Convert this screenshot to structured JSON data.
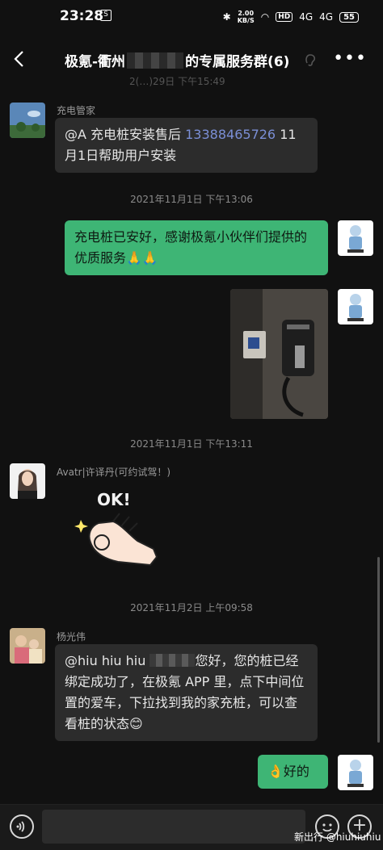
{
  "status_bar": {
    "time": "23:28",
    "network_speed_value": "2.00",
    "network_speed_unit": "KB/S",
    "hd_label": "HD",
    "signal_1": "4G",
    "signal_2": "4G",
    "battery": "55"
  },
  "header": {
    "title_prefix": "极氪-衢州",
    "title_suffix": "的专属服务群(6)"
  },
  "previous_timestamp": "2(…)29日 下午15:49",
  "messages": [
    {
      "side": "left",
      "sender": "充电管家",
      "text_before": "@A 充电桩安装售后 ",
      "phone": "13388465726",
      "text_after": " 11月1日帮助用户安装"
    },
    {
      "timestamp": "2021年11月1日 下午13:06"
    },
    {
      "side": "right",
      "text": "充电桩已安好，感谢极氪小伙伴们提供的优质服务🙏🙏"
    },
    {
      "side": "right",
      "type": "image",
      "alt": "charger photo"
    },
    {
      "timestamp": "2021年11月1日 下午13:11"
    },
    {
      "side": "left",
      "sender": "Avatr|许译丹(可约试驾！)",
      "type": "sticker",
      "sticker_text": "OK!"
    },
    {
      "timestamp": "2021年11月2日 上午09:58"
    },
    {
      "side": "left",
      "sender": "杨光伟",
      "text_before": "@hiu hiu hiu ",
      "text_after": "您好，您的桩已经绑定成功了，在极氪 APP 里，点下中间位置的爱车，下拉找到我的家充桩，可以查看桩的状态😊"
    },
    {
      "side": "right",
      "text": "👌好的"
    }
  ],
  "watermark": "新出行 @hiuhiuhiu",
  "colors": {
    "background": "#111111",
    "bubble_left": "#2c2c2c",
    "bubble_right": "#3eb575",
    "phone_link": "#7b8fd6"
  },
  "icons": {
    "back": "chevron-left-icon",
    "more": "more-dots-icon",
    "ear": "ear-icon",
    "voice": "voice-icon",
    "emoji": "emoji-icon",
    "plus": "plus-icon"
  }
}
